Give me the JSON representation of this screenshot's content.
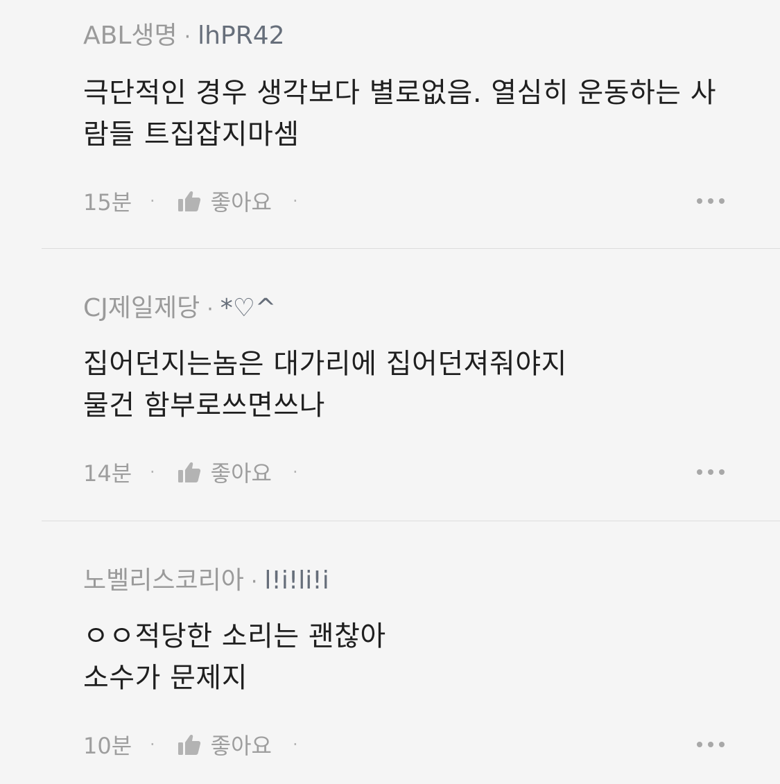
{
  "comments": [
    {
      "author": "ABL생명",
      "author_id": "lhPR42",
      "lines": [
        "극단적인 경우 생각보다 별로없음. 열심히 운동하는 사",
        "람들 트집잡지마셈"
      ],
      "time": "15분",
      "like_label": "좋아요"
    },
    {
      "author": "CJ제일제당",
      "author_id": "*♡^",
      "lines": [
        "집어던지는놈은 대가리에 집어던져줘야지",
        "물건 함부로쓰면쓰나"
      ],
      "time": "14분",
      "like_label": "좋아요"
    },
    {
      "author": "노벨리스코리아",
      "author_id": "l!i!li!i",
      "lines": [
        "ㅇㅇ적당한 소리는 괜찮아",
        "소수가 문제지"
      ],
      "time": "10분",
      "like_label": "좋아요"
    }
  ],
  "separator": "·",
  "icons": {
    "like": "thumbs-up-icon",
    "more": "more-dots-icon"
  },
  "colors": {
    "background": "#f5f5f5",
    "body_text": "#1f1f1f",
    "muted": "#9a9a9a",
    "author_id": "#666e7a"
  }
}
